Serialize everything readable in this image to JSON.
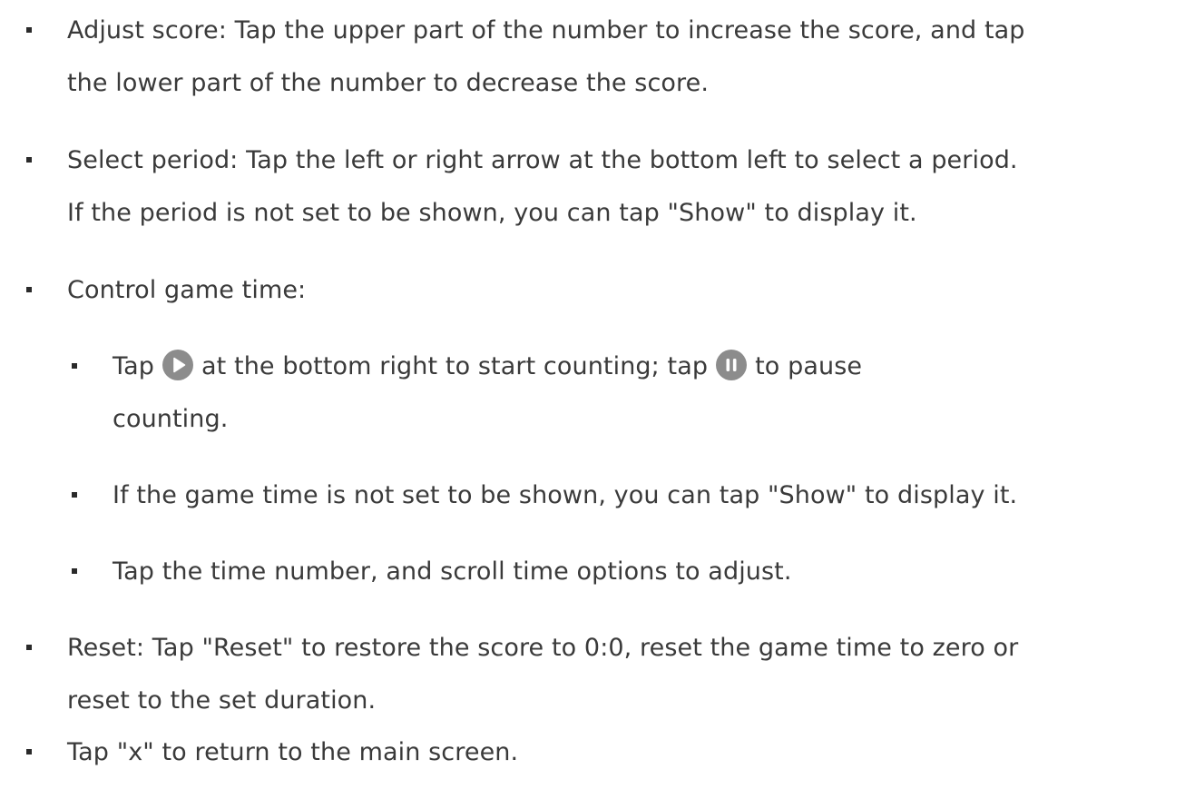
{
  "items": [
    {
      "line1": "Adjust score: Tap the upper part of the number to increase the score, and tap",
      "line2": "the lower part of the number to decrease the score."
    },
    {
      "line1": "Select period: Tap the left or right arrow at the bottom left to select a period.",
      "line2": "If the period is not set to be shown, you can tap \"Show\" to display it."
    },
    {
      "line1": "Control game time:"
    },
    {
      "sub": [
        {
          "part1": "Tap",
          "icon1": "play-icon",
          "part2": "at the bottom right to start counting; tap",
          "icon2": "pause-icon",
          "part3": "to pause",
          "line2": "counting."
        },
        {
          "line1": "If the game time is not set to be shown, you can tap \"Show\" to display it."
        },
        {
          "line1": "Tap the time number, and scroll time options to adjust."
        }
      ]
    },
    {
      "line1": "Reset: Tap \"Reset\" to restore the score to 0:0, reset the game time to zero or",
      "line2": "reset to the set duration."
    },
    {
      "line1": "Tap \"x\" to return to the main screen."
    }
  ],
  "colors": {
    "text": "#3a3a3a",
    "icon_fill": "#8c8c8c",
    "icon_glyph": "#ffffff"
  }
}
